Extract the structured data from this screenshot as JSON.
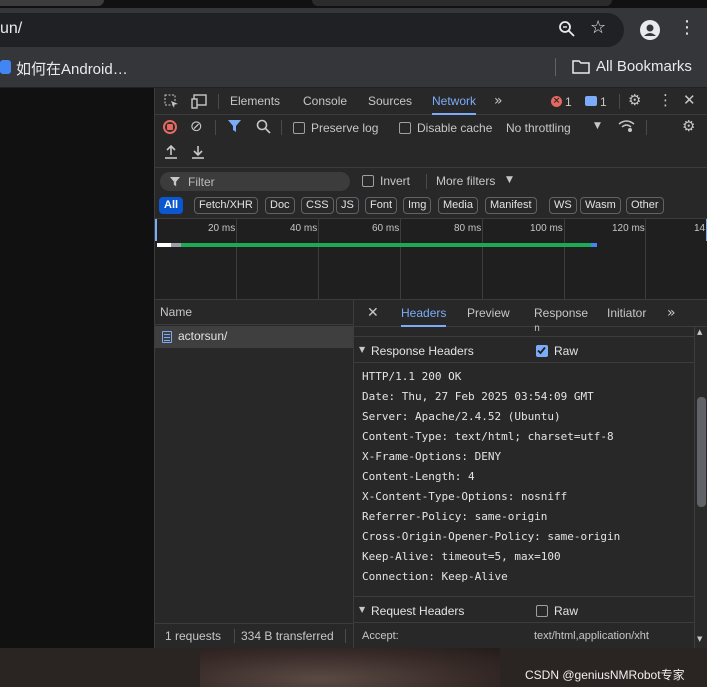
{
  "browser": {
    "url": "un/",
    "bookmark_item": "如何在Android…",
    "all_bookmarks": "All Bookmarks"
  },
  "devtools": {
    "tabs": [
      "Elements",
      "Console",
      "Sources",
      "Network"
    ],
    "active_tab": "Network",
    "error_count": "1",
    "message_count": "1",
    "toolbar": {
      "preserve_log": "Preserve log",
      "disable_cache": "Disable cache",
      "throttling": "No throttling"
    },
    "filter": {
      "placeholder": "Filter",
      "invert": "Invert",
      "more_filters": "More filters"
    },
    "type_chips": [
      "All",
      "Fetch/XHR",
      "Doc",
      "CSS",
      "JS",
      "Font",
      "Img",
      "Media",
      "Manifest",
      "WS",
      "Wasm",
      "Other"
    ],
    "timeline_ticks": [
      "20 ms",
      "40 ms",
      "60 ms",
      "80 ms",
      "100 ms",
      "120 ms",
      "14"
    ],
    "name_header": "Name",
    "requests": [
      {
        "name": "actorsun/"
      }
    ],
    "status": {
      "requests": "1 requests",
      "transferred": "334 B transferred"
    },
    "detail_tabs": [
      "Headers",
      "Preview",
      "Response",
      "Initiator"
    ],
    "active_detail_tab": "Headers",
    "truncated_line": "n",
    "response_headers": {
      "title": "Response Headers",
      "raw_label": "Raw",
      "raw_checked": true,
      "lines": [
        "HTTP/1.1 200 OK",
        "Date: Thu, 27 Feb 2025 03:54:09 GMT",
        "Server: Apache/2.4.52 (Ubuntu)",
        "Content-Type: text/html; charset=utf-8",
        "X-Frame-Options: DENY",
        "Content-Length: 4",
        "X-Content-Type-Options: nosniff",
        "Referrer-Policy: same-origin",
        "Cross-Origin-Opener-Policy: same-origin",
        "Keep-Alive: timeout=5, max=100",
        "Connection: Keep-Alive"
      ]
    },
    "request_headers": {
      "title": "Request Headers",
      "raw_label": "Raw",
      "raw_checked": false,
      "partial_key": "Accept:",
      "partial_value": "text/html,application/xht"
    }
  },
  "watermark": "CSDN @geniusNMRobot专家",
  "colors": {
    "accent": "#7cacf8",
    "waterfall_bar": "#1eaa55",
    "blue_chip": "#0b57d0"
  }
}
